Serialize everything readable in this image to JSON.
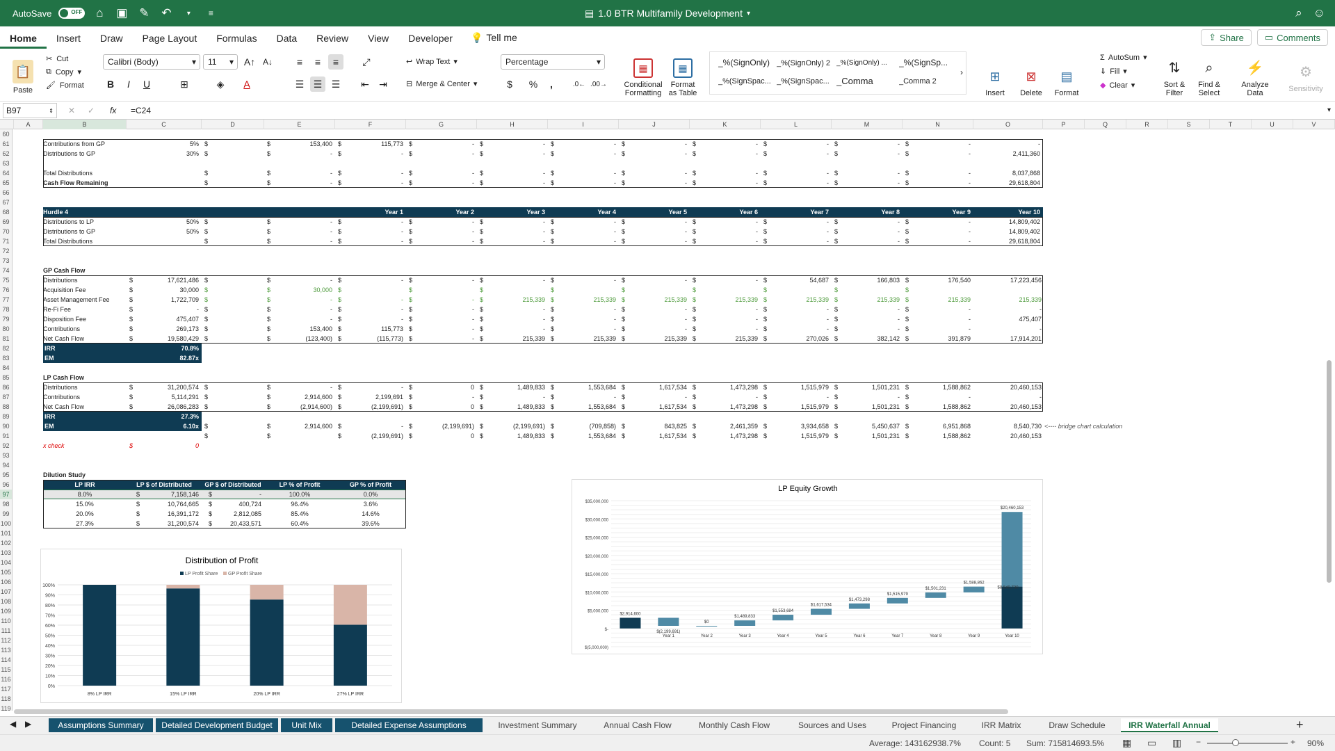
{
  "titlebar": {
    "autosave": "AutoSave",
    "toggle": "OFF",
    "filename": "1.0 BTR Multifamily Development"
  },
  "menu": {
    "tabs": [
      "Home",
      "Insert",
      "Draw",
      "Page Layout",
      "Formulas",
      "Data",
      "Review",
      "View",
      "Developer"
    ],
    "tell_me": "Tell me",
    "share": "Share",
    "comments": "Comments"
  },
  "ribbon": {
    "paste": "Paste",
    "cut": "Cut",
    "copy": "Copy",
    "format": "Format",
    "font_name": "Calibri (Body)",
    "font_size": "11",
    "wrap_text": "Wrap Text",
    "merge_center": "Merge & Center",
    "number_format": "Percentage",
    "conditional": [
      "Conditional",
      "Formatting"
    ],
    "format_table": [
      "Format",
      "as Table"
    ],
    "styles": [
      "_%(SignOnly)",
      "_%(SignOnly) 2",
      "_%(SignOnly) ...",
      "_%(SignSp...",
      "_%(SignSpac...",
      "_%(SignSpac...",
      "_Comma",
      "_Comma 2"
    ],
    "insert": "Insert",
    "delete": "Delete",
    "format_cells": "Format",
    "autosum": "AutoSum",
    "fill": "Fill",
    "clear": "Clear",
    "sort_filter": [
      "Sort &",
      "Filter"
    ],
    "find_select": [
      "Find &",
      "Select"
    ],
    "analyze": [
      "Analyze",
      "Data"
    ],
    "sensitivity": "Sensitivity"
  },
  "formula_bar": {
    "cell": "B97",
    "fx": "fx",
    "formula": "=C24"
  },
  "columns": [
    "A",
    "B",
    "C",
    "D",
    "E",
    "F",
    "G",
    "H",
    "I",
    "J",
    "K",
    "L",
    "M",
    "N",
    "O",
    "P",
    "Q",
    "R",
    "S",
    "T",
    "U",
    "V"
  ],
  "rows": {
    "60": {
      "num": "60"
    },
    "61": {
      "num": "61",
      "label": "Contributions from GP",
      "c": "5%",
      "e": "153,400",
      "f": "115,773",
      "o": "-"
    },
    "62": {
      "num": "62",
      "label": "Distributions to GP",
      "c": "30%",
      "o": "2,411,360"
    },
    "63": {
      "num": "63"
    },
    "64": {
      "num": "64",
      "label": "Total Distributions",
      "o": "8,037,868"
    },
    "65": {
      "num": "65",
      "label": "Cash Flow Remaining",
      "o": "29,618,804"
    },
    "66": {
      "num": "66"
    },
    "67": {
      "num": "67"
    },
    "68": {
      "num": "68",
      "label": "Hurdle 4",
      "years": [
        "Year 1",
        "Year 2",
        "Year 3",
        "Year 4",
        "Year 5",
        "Year 6",
        "Year 7",
        "Year 8",
        "Year 9",
        "Year 10"
      ]
    },
    "69": {
      "num": "69",
      "label": "Distributions to LP",
      "c": "50%",
      "o": "14,809,402"
    },
    "70": {
      "num": "70",
      "label": "Distributions to GP",
      "c": "50%",
      "o": "14,809,402"
    },
    "71": {
      "num": "71",
      "label": "Total Distributions",
      "o": "29,618,804"
    },
    "72": {
      "num": "72"
    },
    "73": {
      "num": "73"
    },
    "74": {
      "num": "74",
      "label": "GP Cash Flow"
    },
    "75": {
      "num": "75",
      "label": "Distributions",
      "c": "17,621,486",
      "vals": [
        "-",
        "-",
        "-",
        "-",
        "-",
        "-",
        "-",
        "54,687",
        "166,803",
        "176,540",
        "17,223,456"
      ]
    },
    "76": {
      "num": "76",
      "label": "Acquisition Fee",
      "c": "30,000",
      "vals": [
        "30,000",
        "",
        "",
        "",
        "",
        "",
        "",
        "",
        "",
        "",
        ""
      ]
    },
    "77": {
      "num": "77",
      "label": "Asset Management Fee",
      "c": "1,722,709",
      "vals": [
        "-",
        "-",
        "-",
        "215,339",
        "215,339",
        "215,339",
        "215,339",
        "215,339",
        "215,339",
        "215,339",
        "215,339"
      ]
    },
    "78": {
      "num": "78",
      "label": "Re-Fi Fee",
      "c": "-",
      "vals": [
        "-",
        "-",
        "-",
        "-",
        "-",
        "-",
        "-",
        "-",
        "-",
        "-",
        "-"
      ]
    },
    "79": {
      "num": "79",
      "label": "Disposition Fee",
      "c": "475,407",
      "vals": [
        "-",
        "-",
        "-",
        "-",
        "-",
        "-",
        "-",
        "-",
        "-",
        "-",
        "475,407"
      ]
    },
    "80": {
      "num": "80",
      "label": "Contributions",
      "c": "269,173",
      "vals": [
        "153,400",
        "115,773",
        "-",
        "-",
        "-",
        "-",
        "-",
        "-",
        "-",
        "-",
        "-"
      ]
    },
    "81": {
      "num": "81",
      "label": "Net Cash Flow",
      "c": "19,580,429",
      "vals": [
        "(123,400)",
        "(115,773)",
        "-",
        "215,339",
        "215,339",
        "215,339",
        "215,339",
        "270,026",
        "382,142",
        "391,879",
        "17,914,201"
      ]
    },
    "82": {
      "num": "82",
      "label": "IRR",
      "c": "70.8%"
    },
    "83": {
      "num": "83",
      "label": "EM",
      "c": "82.87x"
    },
    "84": {
      "num": "84"
    },
    "85": {
      "num": "85",
      "label": "LP Cash Flow"
    },
    "86": {
      "num": "86",
      "label": "Distributions",
      "c": "31,200,574",
      "vals": [
        "-",
        "-",
        "0",
        "1,489,833",
        "1,553,684",
        "1,617,534",
        "1,473,298",
        "1,515,979",
        "1,501,231",
        "1,588,862",
        "20,460,153"
      ]
    },
    "87": {
      "num": "87",
      "label": "Contributions",
      "c": "5,114,291",
      "vals": [
        "2,914,600",
        "2,199,691",
        "-",
        "-",
        "-",
        "-",
        "-",
        "-",
        "-",
        "-",
        "-"
      ]
    },
    "88": {
      "num": "88",
      "label": "Net Cash Flow",
      "c": "26,086,283",
      "vals": [
        "(2,914,600)",
        "(2,199,691)",
        "0",
        "1,489,833",
        "1,553,684",
        "1,617,534",
        "1,473,298",
        "1,515,979",
        "1,501,231",
        "1,588,862",
        "20,460,153"
      ]
    },
    "89": {
      "num": "89",
      "label": "IRR",
      "c": "27.3%"
    },
    "90": {
      "num": "90",
      "label": "EM",
      "c": "6.10x",
      "vals": [
        "2,914,600",
        "-",
        "(2,199,691)",
        "(2,199,691)",
        "(709,858)",
        "843,825",
        "2,461,359",
        "3,934,658",
        "5,450,637",
        "6,951,868",
        "8,540,730"
      ],
      "note": "<---- bridge chart calculation"
    },
    "91": {
      "num": "91",
      "vals": [
        "",
        "(2,199,691)",
        "0",
        "1,489,833",
        "1,553,684",
        "1,617,534",
        "1,473,298",
        "1,515,979",
        "1,501,231",
        "1,588,862",
        "20,460,153"
      ]
    },
    "92": {
      "num": "92",
      "label": "x check",
      "c": "0"
    },
    "93": {
      "num": "93"
    },
    "94": {
      "num": "94"
    },
    "95": {
      "num": "95",
      "label": "Dilution Study"
    },
    "96": {
      "num": "96",
      "hdr": [
        "LP IRR",
        "LP $ of Distributed",
        "GP $ of Distributed",
        "LP % of Profit",
        "GP % of Profit"
      ]
    },
    "97": {
      "num": "97",
      "vals": [
        "8.0%",
        "7,158,146",
        "-",
        "100.0%",
        "0.0%"
      ]
    },
    "98": {
      "num": "98",
      "vals": [
        "15.0%",
        "10,764,665",
        "400,724",
        "96.4%",
        "3.6%"
      ]
    },
    "99": {
      "num": "99",
      "vals": [
        "20.0%",
        "16,391,172",
        "2,812,085",
        "85.4%",
        "14.6%"
      ]
    },
    "100": {
      "num": "100",
      "vals": [
        "27.3%",
        "31,200,574",
        "20,433,571",
        "60.4%",
        "39.6%"
      ]
    },
    "more": [
      "101",
      "102",
      "103",
      "104",
      "105",
      "106",
      "107",
      "108",
      "109",
      "110",
      "111",
      "112",
      "113",
      "114",
      "115",
      "116",
      "117",
      "118",
      "119"
    ]
  },
  "dollar": "$",
  "chart_data": [
    {
      "type": "bar",
      "title": "Distribution of Profit",
      "legend": [
        "LP Profit Share",
        "GP Profit Share"
      ],
      "categories": [
        "8%  LP IRR",
        "15%  LP IRR",
        "20%  LP IRR",
        "27%  LP IRR"
      ],
      "series": [
        {
          "name": "LP Profit Share",
          "values": [
            100.0,
            96.4,
            85.4,
            60.4
          ],
          "color": "#0f3b53"
        },
        {
          "name": "GP Profit Share",
          "values": [
            0.0,
            3.6,
            14.6,
            39.6
          ],
          "color": "#d9b5a8"
        }
      ],
      "yticks": [
        "100%",
        "90%",
        "80%",
        "70%",
        "60%",
        "50%",
        "40%",
        "30%",
        "20%",
        "10%",
        "0%"
      ],
      "ylim": [
        0,
        100
      ],
      "legend_position": "top"
    },
    {
      "type": "bar",
      "title": "LP Equity Growth",
      "categories": [
        "Year 1",
        "Year 2",
        "Year 3",
        "Year 4",
        "Year 5",
        "Year 6",
        "Year 7",
        "Year 8",
        "Year 9",
        "Year 10"
      ],
      "bases": [
        0,
        2914600,
        0,
        0,
        1489833,
        3043517,
        4661051,
        6134349,
        7650328,
        8540730
      ],
      "deltas": [
        2914600,
        -2199691,
        0,
        1489833,
        1553684,
        1617534,
        1473298,
        1515979,
        1501231,
        1588862,
        20460153
      ],
      "labels": [
        "$2,914,600",
        "$(2,199,691)",
        "$0",
        "$1,489,833",
        "$1,553,684",
        "$1,617,534",
        "$1,473,298",
        "$1,515,979",
        "$1,501,231",
        "$1,588,862",
        "$20,460,153"
      ],
      "end_label": "$8,540,730",
      "yticks": [
        "$35,000,000",
        "$30,000,000",
        "$25,000,000",
        "$20,000,000",
        "$15,000,000",
        "$10,000,000",
        "$5,000,000",
        "$-",
        "$(5,000,000)"
      ],
      "ylim": [
        -5000000,
        35000000
      ]
    }
  ],
  "sheets": [
    "Assumptions Summary",
    "Detailed Development Budget",
    "Unit Mix",
    "Detailed Expense Assumptions",
    "Investment Summary",
    "Annual Cash Flow",
    "Monthly Cash Flow",
    "Sources and Uses",
    "Project Financing",
    "IRR Matrix",
    "Draw Schedule",
    "IRR Waterfall Annual"
  ],
  "status": {
    "average": "Average: 143162938.7%",
    "count": "Count: 5",
    "sum": "Sum: 715814693.5%",
    "zoom": "90%"
  }
}
